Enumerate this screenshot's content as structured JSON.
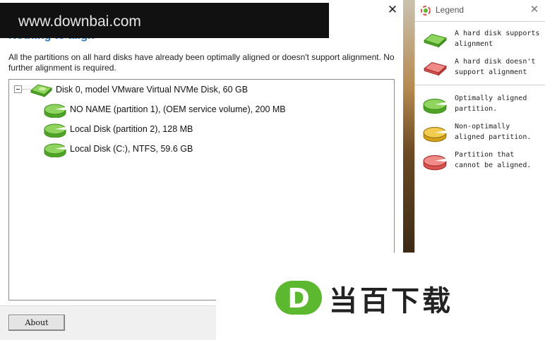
{
  "main": {
    "heading": "Nothing to align",
    "description": "All the partitions on all hard disks have already been optimally aligned or doesn't support alignment. No further alignment is required.",
    "tree": [
      {
        "label": "Disk 0, model VMware Virtual NVMe Disk, 60 GB",
        "type": "disk",
        "icon": "hard-disk-icon"
      },
      {
        "label": "NO NAME (partition 1),  (OEM service volume), 200 MB",
        "type": "partition",
        "status": "optimally-aligned"
      },
      {
        "label": "Local Disk (partition 2), 128 MB",
        "type": "partition",
        "status": "optimally-aligned"
      },
      {
        "label": "Local Disk (C:), NTFS, 59.6 GB",
        "type": "partition",
        "status": "optimally-aligned"
      }
    ],
    "about_label": "About"
  },
  "legend": {
    "title": "Legend",
    "items": [
      {
        "text": "A hard disk supports alignment",
        "icon": "disk-supports-icon",
        "color": "#5cb82e"
      },
      {
        "text": "A hard disk doesn't support alignment",
        "icon": "disk-unsupported-icon",
        "color": "#d9534f"
      },
      {
        "text": "Optimally aligned partition.",
        "icon": "partition-green-icon",
        "color": "#5cb82e"
      },
      {
        "text": "Non-optimally aligned partition.",
        "icon": "partition-yellow-icon",
        "color": "#d4a017"
      },
      {
        "text": "Partition that cannot be aligned.",
        "icon": "partition-red-icon",
        "color": "#d9534f"
      }
    ]
  },
  "watermark": {
    "url_text": "www.downbai.com",
    "logo_letter": "D",
    "logo_text": "当百下载"
  }
}
